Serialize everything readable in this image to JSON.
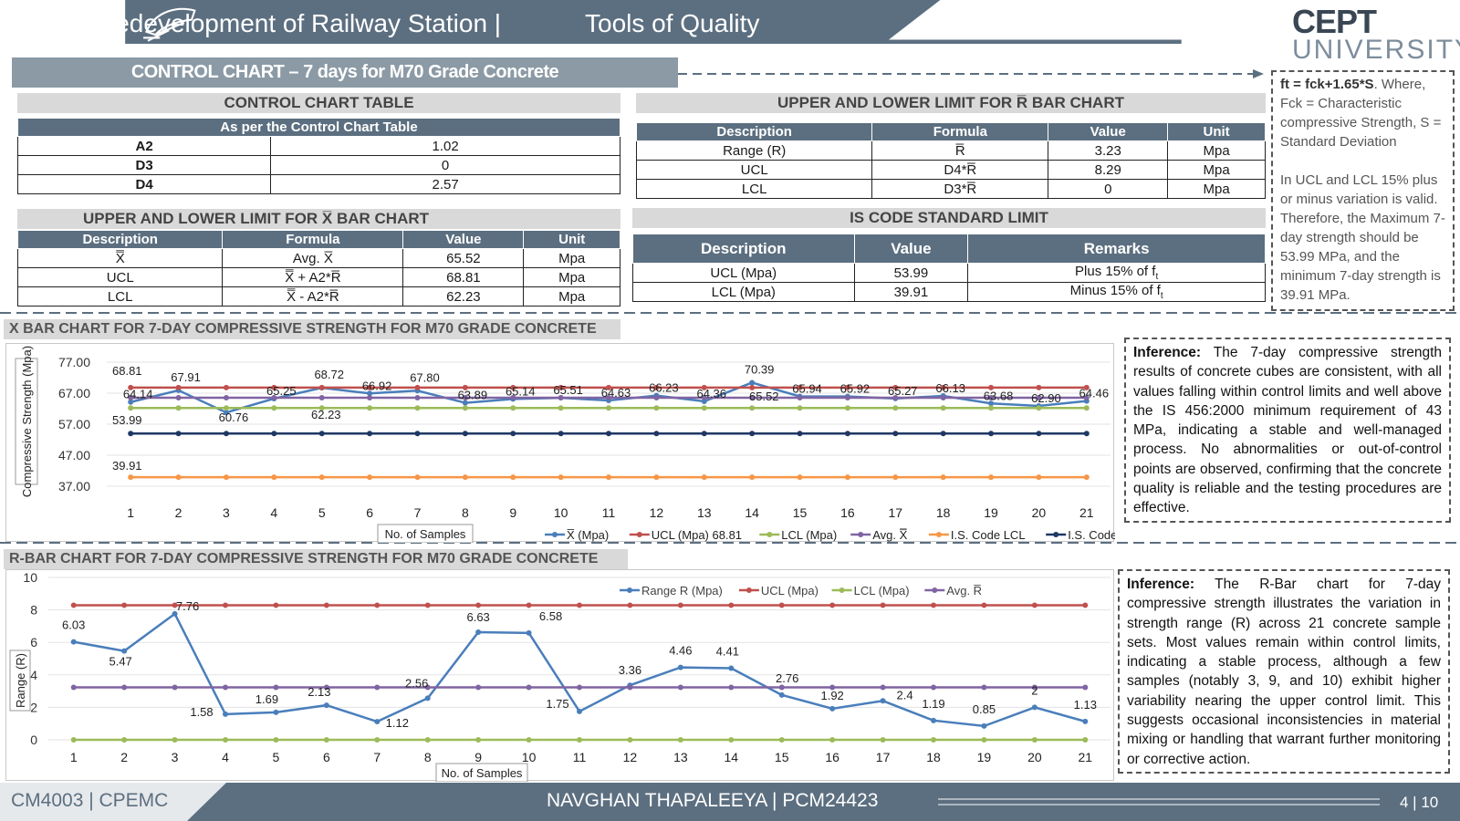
{
  "header": {
    "title_left": "Redevelopment of Railway Station |",
    "title_right": "Tools of Quality",
    "logo_top": "CEPT",
    "logo_bottom": "UNIVERSITY"
  },
  "main_title": "CONTROL CHART – 7 days  for M70 Grade Concrete",
  "control_table": {
    "banner": "CONTROL CHART TABLE",
    "header": "As per the Control Chart Table",
    "rows": [
      [
        "A2",
        "1.02"
      ],
      [
        "D3",
        "0"
      ],
      [
        "D4",
        "2.57"
      ]
    ]
  },
  "xbar_limits": {
    "banner": "UPPER AND LOWER LIMIT FOR X̅ BAR CHART",
    "columns": [
      "Description",
      "Formula",
      "Value",
      "Unit"
    ],
    "rows": [
      [
        "X̿",
        "Avg. X̅",
        "65.52",
        "Mpa"
      ],
      [
        "UCL",
        "X̿ + A2*R̅",
        "68.81",
        "Mpa"
      ],
      [
        "LCL",
        "X̿ - A2*R̅",
        "62.23",
        "Mpa"
      ]
    ]
  },
  "rbar_limits": {
    "banner": "UPPER AND LOWER LIMIT FOR R̅ BAR CHART",
    "columns": [
      "Description",
      "Formula",
      "Value",
      "Unit"
    ],
    "rows": [
      [
        "Range (R)",
        "R̅",
        "3.23",
        "Mpa"
      ],
      [
        "UCL",
        "D4*R̅",
        "8.29",
        "Mpa"
      ],
      [
        "LCL",
        "D3*R̅",
        "0",
        "Mpa"
      ]
    ]
  },
  "is_code": {
    "banner": "IS CODE STANDARD LIMIT",
    "columns": [
      "Description",
      "Value",
      "Remarks"
    ],
    "rows": [
      [
        "UCL (Mpa)",
        "53.99",
        "Plus 15% of f",
        "t"
      ],
      [
        "LCL (Mpa)",
        "39.91",
        "Minus 15% of f",
        "t"
      ]
    ]
  },
  "note": {
    "formula": "ft = fck+1.65*S",
    "line1": ". Where, Fck = Characteristic compressive Strength, S = Standard Deviation",
    "line2": "In UCL and LCL 15% plus or minus variation is valid. Therefore, the Maximum 7-day strength should be 53.99 MPa, and the minimum 7-day strength is 39.91 MPa."
  },
  "xbar_section": {
    "banner": "X BAR CHART FOR 7-DAY COMPRESSIVE STRENGTH FOR M70 GRADE CONCRETE",
    "inference_label": "Inference:",
    "inference_text": " The 7-day compressive strength results of concrete cubes are consistent, with all values falling within control limits and well above the IS 456:2000 minimum requirement of 43 MPa, indicating a stable and well-managed process. No abnormalities or out-of-control points are observed, confirming that the concrete quality is reliable and the testing procedures are effective."
  },
  "rbar_section": {
    "banner": "R-BAR CHART FOR 7-DAY COMPRESSIVE STRENGTH FOR M70 GRADE CONCRETE",
    "inference_label": "Inference:",
    "inference_text": " The R-Bar chart for 7-day compressive strength illustrates the variation in strength range (R) across 21 concrete sample sets. Most values remain within control limits, indicating a stable process, although a few samples (notably 3, 9, and 10) exhibit higher variability nearing the upper control limit. This suggests occasional inconsistencies in material mixing or handling that warrant further monitoring or corrective action."
  },
  "footer": {
    "left": "CM4003 | CPEMC",
    "center": "NAVGHAN THAPALEEYA | PCM24423",
    "page": "4 | 10"
  },
  "colors": {
    "header_band": "#5c6f80",
    "blue": "#4a7ebb",
    "red": "#c0504d",
    "green": "#9bbb59",
    "purple": "#8064a2",
    "orange": "#f79646",
    "navy": "#1f3864"
  },
  "chart_data": [
    {
      "type": "line",
      "ylabel": "Compressive Strength (Mpa)",
      "xlabel": "No. of Samples",
      "ylim": [
        37,
        77
      ],
      "yticks": [
        "37.00",
        "47.00",
        "57.00",
        "67.00",
        "77.00"
      ],
      "x": [
        1,
        2,
        3,
        4,
        5,
        6,
        7,
        8,
        9,
        10,
        11,
        12,
        13,
        14,
        15,
        16,
        17,
        18,
        19,
        20,
        21
      ],
      "legend_position": "bottom",
      "series": [
        {
          "name": "X̅ (Mpa)",
          "color": "#4a7ebb",
          "values": [
            64.14,
            67.91,
            60.76,
            65.25,
            68.72,
            66.92,
            67.8,
            63.89,
            65.14,
            65.51,
            64.63,
            66.23,
            64.36,
            70.39,
            65.94,
            65.92,
            65.27,
            66.13,
            63.68,
            62.9,
            64.46
          ]
        },
        {
          "name": "UCL (Mpa) 68.81",
          "color": "#c0504d",
          "constant": 68.81
        },
        {
          "name": "LCL (Mpa)",
          "color": "#9bbb59",
          "constant": 62.23
        },
        {
          "name": "Avg. X̿",
          "color": "#8064a2",
          "constant": 65.52
        },
        {
          "name": "I.S. Code LCL",
          "color": "#f79646",
          "constant": 39.91
        },
        {
          "name": "I.S. Code UCL",
          "color": "#1f3864",
          "constant": 53.99
        }
      ],
      "annotations": [
        "68.81",
        "65.52",
        "62.23",
        "53.99",
        "39.91"
      ]
    },
    {
      "type": "line",
      "ylabel": "Range (R)",
      "xlabel": "No. of Samples",
      "ylim": [
        0,
        10
      ],
      "yticks": [
        "0",
        "2",
        "4",
        "6",
        "8",
        "10"
      ],
      "x": [
        1,
        2,
        3,
        4,
        5,
        6,
        7,
        8,
        9,
        10,
        11,
        12,
        13,
        14,
        15,
        16,
        17,
        18,
        19,
        20,
        21
      ],
      "legend_position": "top",
      "series": [
        {
          "name": "Range R (Mpa)",
          "color": "#4a7ebb",
          "values": [
            6.03,
            5.47,
            7.76,
            1.58,
            1.69,
            2.13,
            1.12,
            2.56,
            6.63,
            6.58,
            1.75,
            3.36,
            4.46,
            4.41,
            2.76,
            1.92,
            2.4,
            1.19,
            0.85,
            2,
            1.13
          ]
        },
        {
          "name": "UCL (Mpa)",
          "color": "#c0504d",
          "constant": 8.29
        },
        {
          "name": "LCL (Mpa)",
          "color": "#9bbb59",
          "constant": 0
        },
        {
          "name": "Avg. R̅",
          "color": "#8064a2",
          "constant": 3.23
        }
      ]
    }
  ]
}
